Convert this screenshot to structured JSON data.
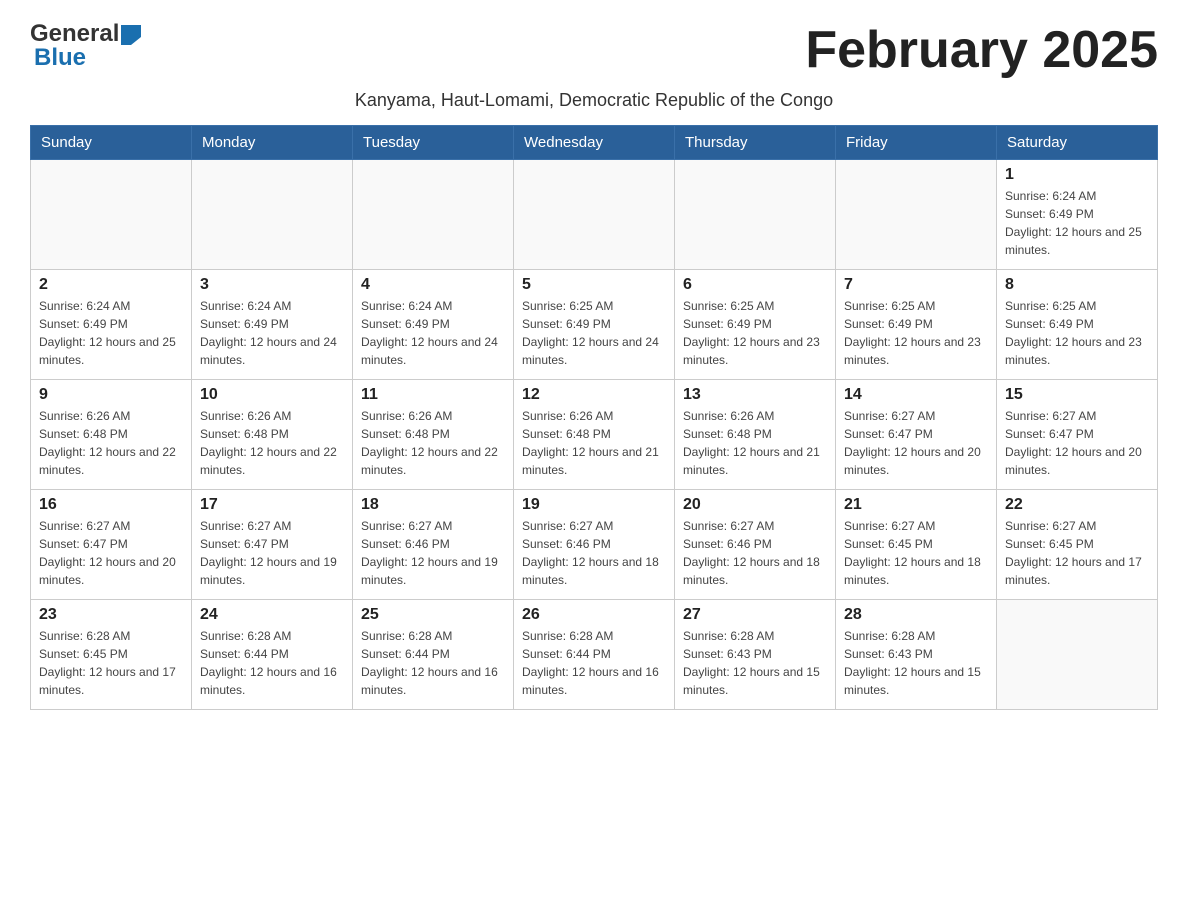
{
  "header": {
    "logo_general": "General",
    "logo_blue": "Blue",
    "month_title": "February 2025",
    "subtitle": "Kanyama, Haut-Lomami, Democratic Republic of the Congo"
  },
  "days_of_week": [
    "Sunday",
    "Monday",
    "Tuesday",
    "Wednesday",
    "Thursday",
    "Friday",
    "Saturday"
  ],
  "weeks": [
    [
      {
        "day": "",
        "info": ""
      },
      {
        "day": "",
        "info": ""
      },
      {
        "day": "",
        "info": ""
      },
      {
        "day": "",
        "info": ""
      },
      {
        "day": "",
        "info": ""
      },
      {
        "day": "",
        "info": ""
      },
      {
        "day": "1",
        "info": "Sunrise: 6:24 AM\nSunset: 6:49 PM\nDaylight: 12 hours and 25 minutes."
      }
    ],
    [
      {
        "day": "2",
        "info": "Sunrise: 6:24 AM\nSunset: 6:49 PM\nDaylight: 12 hours and 25 minutes."
      },
      {
        "day": "3",
        "info": "Sunrise: 6:24 AM\nSunset: 6:49 PM\nDaylight: 12 hours and 24 minutes."
      },
      {
        "day": "4",
        "info": "Sunrise: 6:24 AM\nSunset: 6:49 PM\nDaylight: 12 hours and 24 minutes."
      },
      {
        "day": "5",
        "info": "Sunrise: 6:25 AM\nSunset: 6:49 PM\nDaylight: 12 hours and 24 minutes."
      },
      {
        "day": "6",
        "info": "Sunrise: 6:25 AM\nSunset: 6:49 PM\nDaylight: 12 hours and 23 minutes."
      },
      {
        "day": "7",
        "info": "Sunrise: 6:25 AM\nSunset: 6:49 PM\nDaylight: 12 hours and 23 minutes."
      },
      {
        "day": "8",
        "info": "Sunrise: 6:25 AM\nSunset: 6:49 PM\nDaylight: 12 hours and 23 minutes."
      }
    ],
    [
      {
        "day": "9",
        "info": "Sunrise: 6:26 AM\nSunset: 6:48 PM\nDaylight: 12 hours and 22 minutes."
      },
      {
        "day": "10",
        "info": "Sunrise: 6:26 AM\nSunset: 6:48 PM\nDaylight: 12 hours and 22 minutes."
      },
      {
        "day": "11",
        "info": "Sunrise: 6:26 AM\nSunset: 6:48 PM\nDaylight: 12 hours and 22 minutes."
      },
      {
        "day": "12",
        "info": "Sunrise: 6:26 AM\nSunset: 6:48 PM\nDaylight: 12 hours and 21 minutes."
      },
      {
        "day": "13",
        "info": "Sunrise: 6:26 AM\nSunset: 6:48 PM\nDaylight: 12 hours and 21 minutes."
      },
      {
        "day": "14",
        "info": "Sunrise: 6:27 AM\nSunset: 6:47 PM\nDaylight: 12 hours and 20 minutes."
      },
      {
        "day": "15",
        "info": "Sunrise: 6:27 AM\nSunset: 6:47 PM\nDaylight: 12 hours and 20 minutes."
      }
    ],
    [
      {
        "day": "16",
        "info": "Sunrise: 6:27 AM\nSunset: 6:47 PM\nDaylight: 12 hours and 20 minutes."
      },
      {
        "day": "17",
        "info": "Sunrise: 6:27 AM\nSunset: 6:47 PM\nDaylight: 12 hours and 19 minutes."
      },
      {
        "day": "18",
        "info": "Sunrise: 6:27 AM\nSunset: 6:46 PM\nDaylight: 12 hours and 19 minutes."
      },
      {
        "day": "19",
        "info": "Sunrise: 6:27 AM\nSunset: 6:46 PM\nDaylight: 12 hours and 18 minutes."
      },
      {
        "day": "20",
        "info": "Sunrise: 6:27 AM\nSunset: 6:46 PM\nDaylight: 12 hours and 18 minutes."
      },
      {
        "day": "21",
        "info": "Sunrise: 6:27 AM\nSunset: 6:45 PM\nDaylight: 12 hours and 18 minutes."
      },
      {
        "day": "22",
        "info": "Sunrise: 6:27 AM\nSunset: 6:45 PM\nDaylight: 12 hours and 17 minutes."
      }
    ],
    [
      {
        "day": "23",
        "info": "Sunrise: 6:28 AM\nSunset: 6:45 PM\nDaylight: 12 hours and 17 minutes."
      },
      {
        "day": "24",
        "info": "Sunrise: 6:28 AM\nSunset: 6:44 PM\nDaylight: 12 hours and 16 minutes."
      },
      {
        "day": "25",
        "info": "Sunrise: 6:28 AM\nSunset: 6:44 PM\nDaylight: 12 hours and 16 minutes."
      },
      {
        "day": "26",
        "info": "Sunrise: 6:28 AM\nSunset: 6:44 PM\nDaylight: 12 hours and 16 minutes."
      },
      {
        "day": "27",
        "info": "Sunrise: 6:28 AM\nSunset: 6:43 PM\nDaylight: 12 hours and 15 minutes."
      },
      {
        "day": "28",
        "info": "Sunrise: 6:28 AM\nSunset: 6:43 PM\nDaylight: 12 hours and 15 minutes."
      },
      {
        "day": "",
        "info": ""
      }
    ]
  ]
}
